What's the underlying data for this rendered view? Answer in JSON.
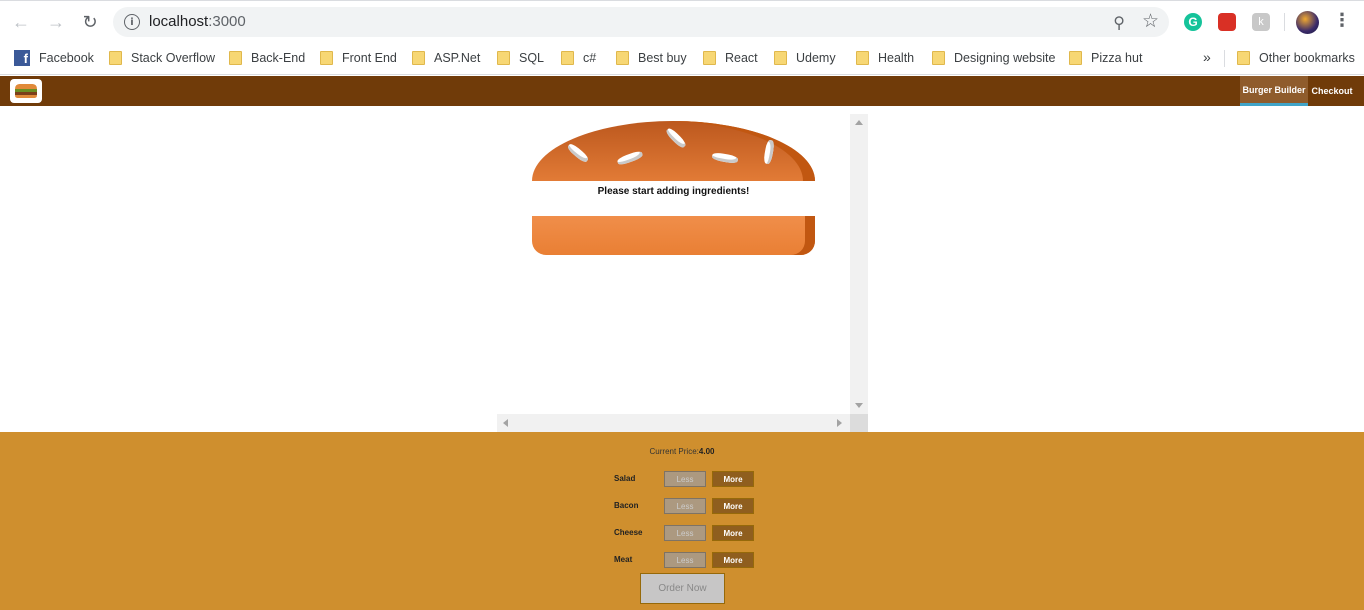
{
  "browser": {
    "url_host": "localhost",
    "url_port": ":3000",
    "bookmarks": [
      "Facebook",
      "Stack Overflow",
      "Back-End",
      "Front End",
      "ASP.Net",
      "SQL",
      "c#",
      "Best buy",
      "React",
      "Udemy",
      "Health",
      "Designing website",
      "Pizza hut"
    ],
    "more_label": "»",
    "other_bookmarks": "Other bookmarks"
  },
  "app": {
    "nav": {
      "burger_builder": "Burger Builder",
      "checkout": "Checkout"
    },
    "burger": {
      "message": "Please start adding ingredients!"
    },
    "controls": {
      "price_label": "Current Price:",
      "price_value": "4.00",
      "less_label": "Less",
      "more_label": "More",
      "ingredients": [
        "Salad",
        "Bacon",
        "Cheese",
        "Meat"
      ],
      "order_label": "Order Now"
    }
  }
}
